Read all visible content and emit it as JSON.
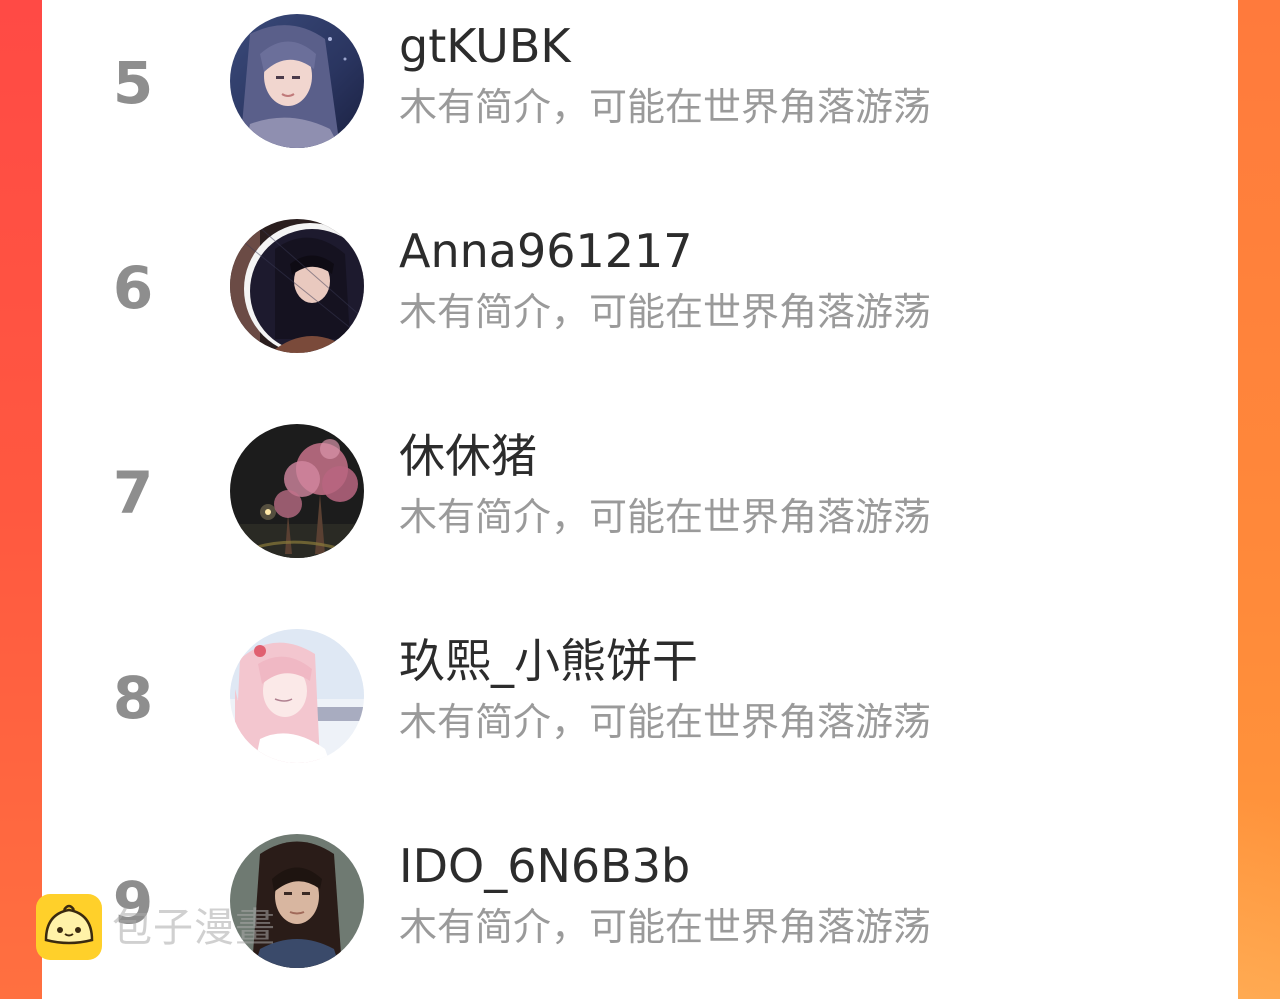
{
  "theme": {
    "background_left": "#ff4a45",
    "background_right": "#ff8a3a",
    "rank_color": "#8e8e8e",
    "name_color": "#2c2c2c",
    "bio_color": "#9a9a9a"
  },
  "users": [
    {
      "rank": "5",
      "name": "gtKUBK",
      "bio": "木有简介，可能在世界角落游荡",
      "avatar": "anime-girl-avatar"
    },
    {
      "rank": "6",
      "name": "Anna961217",
      "bio": "木有简介，可能在世界角落游荡",
      "avatar": "girl-portrait-avatar"
    },
    {
      "rank": "7",
      "name": "休休猪",
      "bio": "木有简介，可能在世界角落游荡",
      "avatar": "blossom-tree-night-avatar"
    },
    {
      "rank": "8",
      "name": "玖熙_小熊饼干",
      "bio": "木有简介，可能在世界角落游荡",
      "avatar": "pink-hair-anime-avatar"
    },
    {
      "rank": "9",
      "name": "IDO_6N6B3b",
      "bio": "木有简介，可能在世界角落游荡",
      "avatar": "woman-portrait-avatar"
    }
  ],
  "watermark": {
    "text": "包子漫畫",
    "icon": "bun-mascot-icon"
  }
}
